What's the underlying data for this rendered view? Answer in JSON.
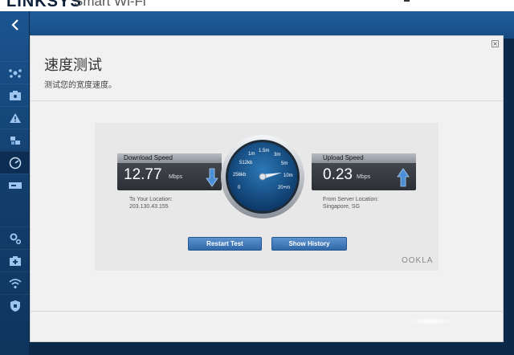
{
  "app": {
    "brand": "LINKSYS",
    "product": "Smart Wi-Fi"
  },
  "page": {
    "title": "速度测试",
    "subtitle": "测试您的宽度速度。"
  },
  "sidebar": {
    "items": [
      {
        "icon": "network-map-icon"
      },
      {
        "icon": "guest-access-icon"
      },
      {
        "icon": "parental-controls-icon"
      },
      {
        "icon": "media-prioritization-icon"
      },
      {
        "icon": "speed-test-icon",
        "active": true
      },
      {
        "icon": "external-storage-icon"
      },
      {
        "icon": "connectivity-icon"
      },
      {
        "icon": "troubleshooting-icon"
      },
      {
        "icon": "wireless-icon"
      },
      {
        "icon": "security-icon"
      }
    ]
  },
  "download": {
    "label": "Download Speed",
    "value": "12.77",
    "unit": "Mbps",
    "location_label": "To Your Location:",
    "location_value": "203.130.43.155"
  },
  "upload": {
    "label": "Upload Speed",
    "value": "0.23",
    "unit": "Mbps",
    "location_label": "From Server Location:",
    "location_value": "Singapore, SG"
  },
  "gauge": {
    "ticks": [
      "0",
      "256kb",
      "512kb",
      "1m",
      "1.5m",
      "3m",
      "5m",
      "10m",
      "20+m"
    ],
    "needle_value": "10m"
  },
  "buttons": {
    "restart": "Restart Test",
    "history": "Show History"
  },
  "logo": "OOKLA",
  "colors": {
    "accent": "#2f67a8",
    "sidebar": "#123e6c",
    "arrow": "#4d8fd6"
  }
}
